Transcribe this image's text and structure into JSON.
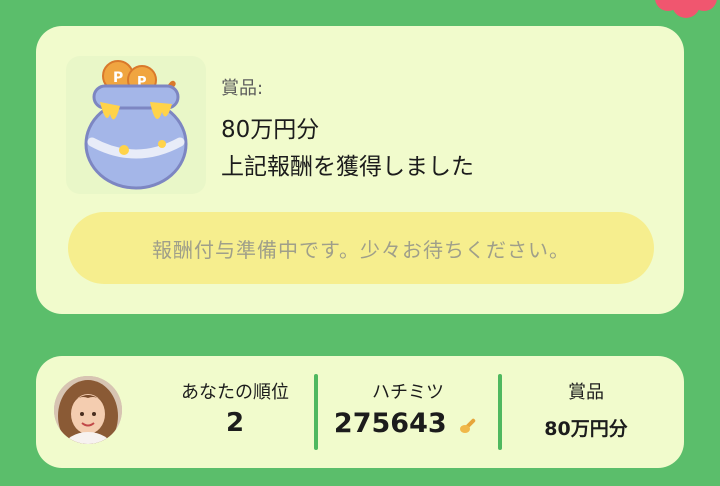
{
  "reward": {
    "prize_label": "賞品:",
    "prize_value": "80万円分",
    "earned_message": "上記報酬を獲得しました",
    "status_message": "報酬付与準備中です。少々お待ちください。",
    "pot_icon": "honey-pot-icon"
  },
  "ranking": {
    "rank_label": "あなたの順位",
    "rank_value": "2",
    "honey_label": "ハチミツ",
    "honey_value": "275643",
    "prize_label": "賞品",
    "prize_value": "80万円分",
    "honey_icon": "honey-dipper-icon"
  },
  "colors": {
    "background": "#5bbe6b",
    "card": "#f1fbcc",
    "status_pill": "#f6ee8e",
    "divider": "#4fb85f",
    "flower": "#f0566f"
  }
}
